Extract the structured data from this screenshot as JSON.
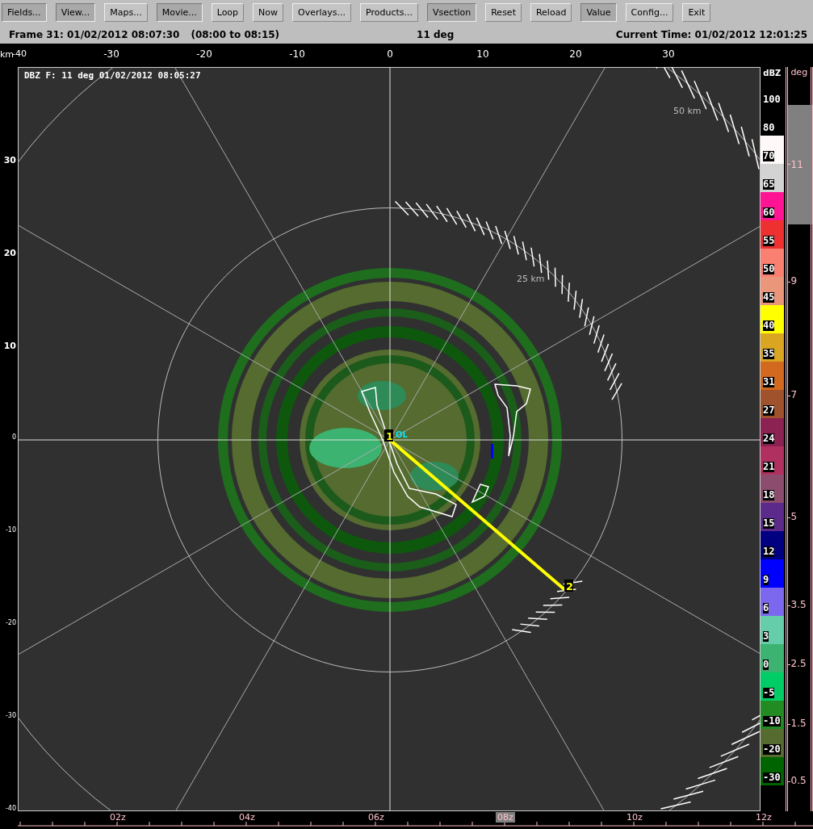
{
  "toolbar": {
    "buttons": [
      {
        "label": "Fields...",
        "pressed": true
      },
      {
        "label": "View...",
        "pressed": true
      },
      {
        "label": "Maps...",
        "pressed": false
      },
      {
        "label": "Movie...",
        "pressed": true
      },
      {
        "label": "Loop",
        "pressed": false
      },
      {
        "label": "Now",
        "pressed": false
      },
      {
        "label": "Overlays...",
        "pressed": false
      },
      {
        "label": "Products...",
        "pressed": false
      },
      {
        "label": "Vsection",
        "pressed": true
      },
      {
        "label": "Reset",
        "pressed": false
      },
      {
        "label": "Reload",
        "pressed": false
      },
      {
        "label": "Value",
        "pressed": true
      },
      {
        "label": "Config...",
        "pressed": false
      },
      {
        "label": "Exit",
        "pressed": false
      }
    ]
  },
  "status": {
    "frame": "Frame 31: 01/02/2012 08:07:30",
    "interval": "(08:00 to 08:15)",
    "elevation": "11 deg",
    "current_time": "Current Time: 01/02/2012 12:01:25"
  },
  "plot": {
    "title": "DBZ F: 11 deg 01/02/2012 08:05:27",
    "x_axis": {
      "unit": "km",
      "ticks": [
        "-40",
        "-30",
        "-20",
        "-10",
        "0",
        "10",
        "20",
        "30"
      ]
    },
    "y_axis": {
      "ticks": [
        "30",
        "20",
        "10",
        "0",
        "-10",
        "-20",
        "-30",
        "-40"
      ]
    },
    "range_rings": [
      {
        "label": "25 km"
      },
      {
        "label": "50 km"
      }
    ],
    "markers": [
      {
        "label": "1"
      },
      {
        "label": "2"
      }
    ],
    "radar_label": "OL"
  },
  "color_scale": {
    "unit": "dBZ",
    "entries": [
      {
        "label": "100"
      },
      {
        "label": "80"
      },
      {
        "label": "70",
        "color": "#fff8f8"
      },
      {
        "label": "65",
        "color": "#d3d3d3"
      },
      {
        "label": "60",
        "color": "#ff1493"
      },
      {
        "label": "55",
        "color": "#ee3030"
      },
      {
        "label": "50",
        "color": "#fa8072"
      },
      {
        "label": "45",
        "color": "#e9967a"
      },
      {
        "label": "40",
        "color": "#ffff00"
      },
      {
        "label": "35",
        "color": "#daa520"
      },
      {
        "label": "31",
        "color": "#d2691e"
      },
      {
        "label": "27",
        "color": "#a0522d"
      },
      {
        "label": "24",
        "color": "#8b2252"
      },
      {
        "label": "21",
        "color": "#b03060"
      },
      {
        "label": "18",
        "color": "#8b4c6e"
      },
      {
        "label": "15",
        "color": "#5b2a8b"
      },
      {
        "label": "12",
        "color": "#000080"
      },
      {
        "label": "9",
        "color": "#0000ff"
      },
      {
        "label": "6",
        "color": "#7b68ee"
      },
      {
        "label": "3",
        "color": "#66cdaa"
      },
      {
        "label": "0",
        "color": "#3cb371"
      },
      {
        "label": "-5",
        "color": "#00cd66"
      },
      {
        "label": "-10",
        "color": "#228b22"
      },
      {
        "label": "-20",
        "color": "#556b2f"
      },
      {
        "label": "-30",
        "color": "#006400"
      }
    ]
  },
  "elevation_scale": {
    "unit": "deg",
    "ticks": [
      {
        "label": "11",
        "selected": true
      },
      {
        "label": "9",
        "selected": false
      },
      {
        "label": "7",
        "selected": false
      },
      {
        "label": "5",
        "selected": false
      },
      {
        "label": "3.5",
        "selected": false
      },
      {
        "label": "2.5",
        "selected": false
      },
      {
        "label": "1.5",
        "selected": false
      },
      {
        "label": "0.5",
        "selected": false
      }
    ]
  },
  "time_axis": {
    "ticks": [
      {
        "label": "02z",
        "selected": false
      },
      {
        "label": "04z",
        "selected": false
      },
      {
        "label": "06z",
        "selected": false
      },
      {
        "label": "08z",
        "selected": true
      },
      {
        "label": "10z",
        "selected": false
      },
      {
        "label": "12z",
        "selected": false
      }
    ]
  }
}
